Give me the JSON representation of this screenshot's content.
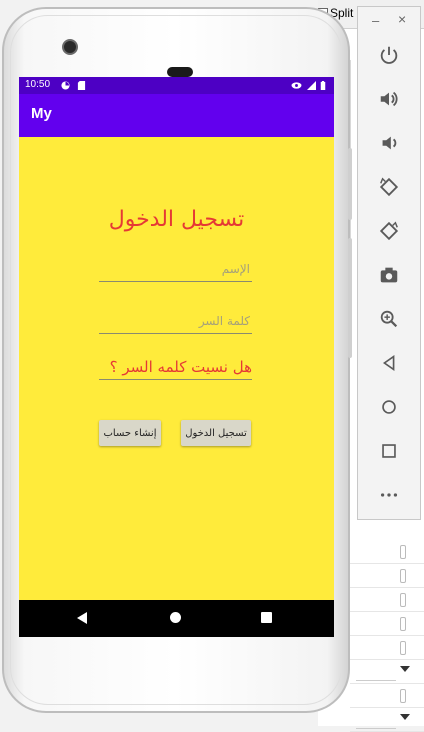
{
  "ide": {
    "split_label": "Split"
  },
  "emulator_toolbar": {
    "minimize": "–",
    "close": "×",
    "buttons": [
      "power-icon",
      "volume-up-icon",
      "volume-down-icon",
      "rotate-left-icon",
      "rotate-right-icon",
      "camera-icon",
      "zoom-icon",
      "back-icon",
      "home-icon",
      "overview-icon",
      "more-icon"
    ]
  },
  "device": {
    "status_bar": {
      "time": "10:50",
      "background": "#4d00c4"
    },
    "app_bar": {
      "title": "My",
      "background": "#6200ee"
    },
    "content": {
      "background": "#ffeb3b",
      "title": "تسجيل الدخول",
      "name_placeholder": "الإسم",
      "password_placeholder": "كلمة السر",
      "forgot_password": "هل نسيت كلمه السر ؟",
      "create_account_button": "إنشاء حساب",
      "login_button": "تسجيل الدخول",
      "accent_text_color": "#e53935"
    }
  }
}
